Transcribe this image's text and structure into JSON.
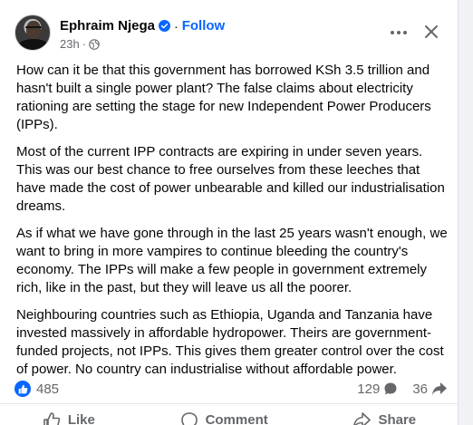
{
  "post": {
    "author": "Ephraim Njega",
    "separator": "·",
    "follow_label": "Follow",
    "time": "23h",
    "time_separator": "·",
    "paragraphs": [
      "How can it be that this government has borrowed KSh 3.5 trillion and hasn't built a single power plant? The false claims about electricity rationing are setting the stage for new Independent Power Producers (IPPs).",
      "Most of the current IPP contracts are expiring in under seven years. This was our best chance to free ourselves from these leeches that have made the cost of power unbearable and killed our industrialisation dreams.",
      "As if what we have gone through in the last 25 years wasn't enough, we want to bring in more vampires to continue bleeding the country's economy. The IPPs will make a few people in government extremely rich, like in the past, but they will leave us all the poorer.",
      "Neighbouring countries such as Ethiopia, Uganda and Tanzania have invested massively in affordable hydropower. Theirs are government-funded projects, not IPPs. This gives them greater control over the cost of power. No country can industrialise without affordable power."
    ],
    "reactions_count": "485",
    "comments_count": "129",
    "shares_count": "36"
  },
  "actions": {
    "like_label": "Like",
    "comment_label": "Comment",
    "share_label": "Share"
  },
  "icons": {
    "verified": "verified-badge-icon",
    "globe": "globe-icon",
    "more": "more-options-icon",
    "close": "close-icon",
    "like": "thumbs-up-icon",
    "comment": "comment-bubble-icon",
    "share": "share-arrow-icon"
  },
  "colors": {
    "accent": "#0866ff",
    "text": "#050505",
    "muted": "#65676b"
  }
}
